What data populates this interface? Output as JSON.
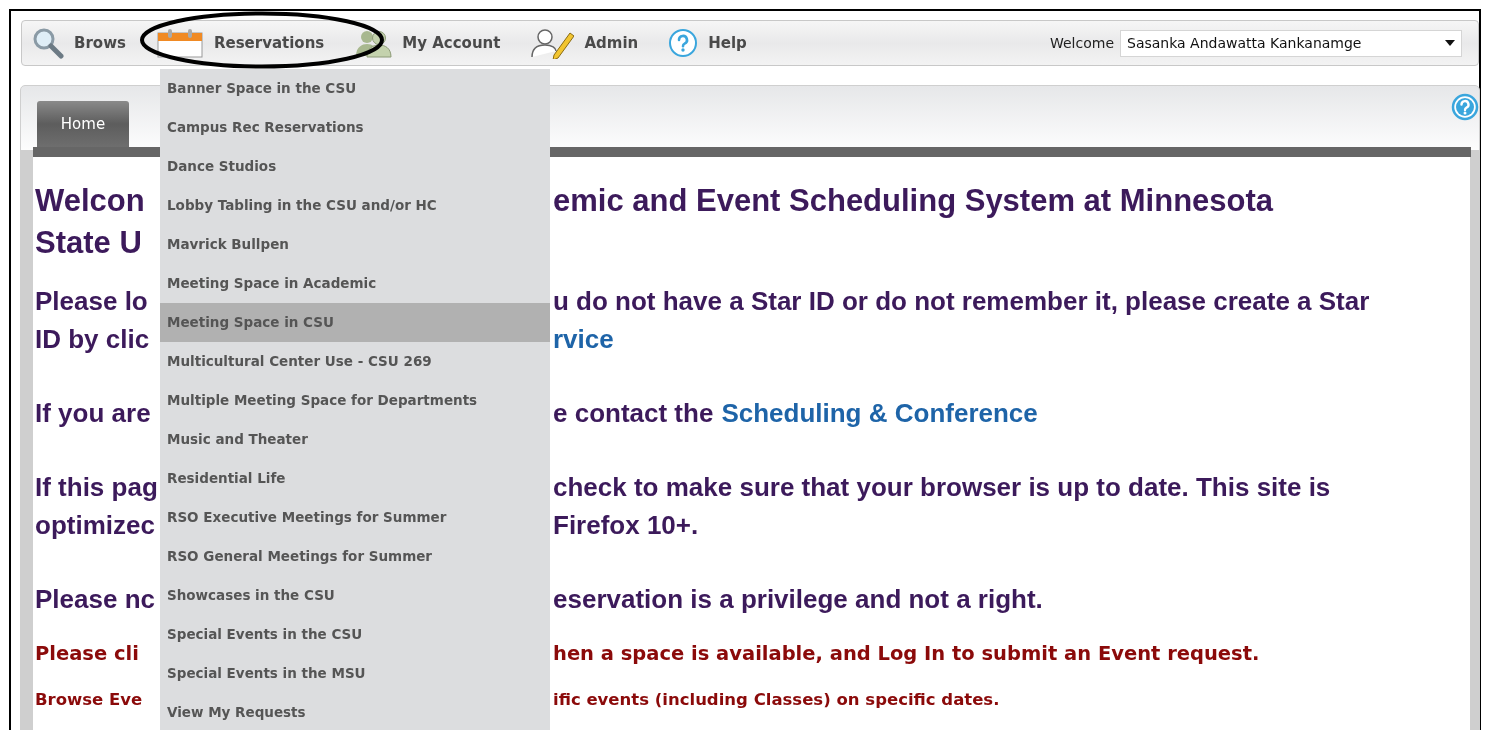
{
  "nav": {
    "items": [
      {
        "kind": "search",
        "label": "Brows"
      },
      {
        "kind": "calendar",
        "label": "Reservations"
      },
      {
        "kind": "people",
        "label": "My Account"
      },
      {
        "kind": "edit",
        "label": "Admin"
      },
      {
        "kind": "help",
        "label": "Help"
      }
    ],
    "welcome": "Welcome",
    "user_select": "Sasanka Andawatta Kankanamge"
  },
  "tabs": [
    {
      "label": "Home",
      "selected": true
    }
  ],
  "content": [
    {
      "kind": "heading",
      "lines": [
        {
          "left": "Welcon",
          "right": [
            {
              "text": "emic and Event Scheduling System at Minnesota",
              "link": false
            }
          ]
        },
        {
          "left": "State U"
        }
      ]
    },
    {
      "kind": "text",
      "lines": [
        {
          "left": "Please lo",
          "right": [
            {
              "text": "u do not have a Star ID or do not remember it, please create a Star",
              "link": false
            }
          ]
        },
        {
          "left": "ID by clic",
          "right": [
            {
              "text": "rvice",
              "link": true
            }
          ]
        }
      ]
    },
    {
      "kind": "text",
      "lines": [
        {
          "left": "If you are",
          "right": [
            {
              "text": "e contact the",
              "link": false
            },
            {
              "text": "Scheduling & Conference",
              "link": true
            }
          ]
        }
      ]
    },
    {
      "kind": "text",
      "lines": [
        {
          "left": "If this pag",
          "right": [
            {
              "text": "check to make sure that your browser is up to date. This site is",
              "link": false
            }
          ]
        },
        {
          "left": "optimizec",
          "right": [
            {
              "text": "Firefox 10+.",
              "link": false
            }
          ]
        }
      ]
    },
    {
      "kind": "text",
      "lines": [
        {
          "left": "Please nc",
          "right": [
            {
              "text": "eservation is a privilege and not a right.",
              "link": false
            }
          ]
        }
      ]
    },
    {
      "kind": "alert",
      "lines": [
        {
          "left": "Please cli",
          "right": [
            {
              "text": "hen a space is available, and Log In to submit an Event request.",
              "link": false
            }
          ]
        }
      ]
    },
    {
      "kind": "note",
      "lines": [
        {
          "left": "Browse Eve",
          "right": [
            {
              "text": "ific events (including Classes) on specific dates.",
              "link": false
            }
          ]
        }
      ]
    }
  ],
  "dropdown": {
    "items": [
      {
        "label": "Banner Space in the CSU",
        "selected": false
      },
      {
        "label": "Campus Rec Reservations",
        "selected": false
      },
      {
        "label": "Dance Studios",
        "selected": false
      },
      {
        "label": "Lobby Tabling in the CSU and/or HC",
        "selected": false
      },
      {
        "label": "Mavrick Bullpen",
        "selected": false
      },
      {
        "label": "Meeting Space in Academic",
        "selected": false
      },
      {
        "label": "Meeting Space in CSU",
        "selected": true
      },
      {
        "label": "Multicultural Center Use - CSU 269",
        "selected": false
      },
      {
        "label": "Multiple Meeting Space for Departments",
        "selected": false
      },
      {
        "label": "Music and Theater",
        "selected": false
      },
      {
        "label": "Residential Life",
        "selected": false
      },
      {
        "label": "RSO Executive Meetings for Summer",
        "selected": false
      },
      {
        "label": "RSO General Meetings for Summer",
        "selected": false
      },
      {
        "label": "Showcases in the CSU",
        "selected": false
      },
      {
        "label": "Special Events in the CSU",
        "selected": false
      },
      {
        "label": "Special Events in the MSU",
        "selected": false
      },
      {
        "label": "View My Requests",
        "selected": false
      }
    ]
  }
}
